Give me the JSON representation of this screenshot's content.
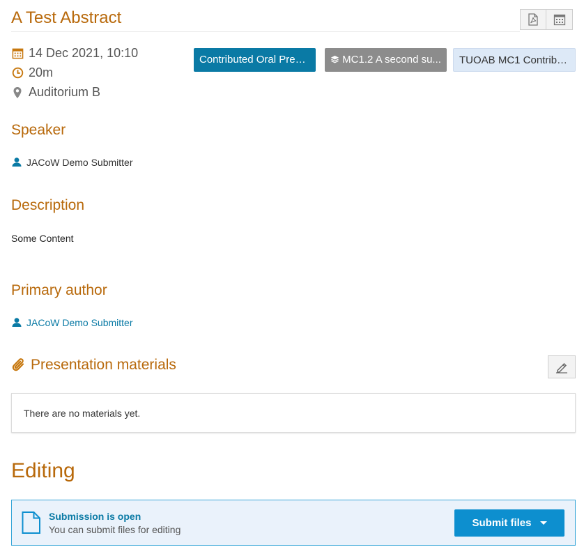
{
  "contribution": {
    "title": "A Test Abstract",
    "date": "14 Dec 2021, 10:10",
    "duration": "20m",
    "location": "Auditorium B"
  },
  "toolbar": {
    "pdf_icon": "pdf-file-icon",
    "calendar_icon": "calendar-icon"
  },
  "tags": {
    "type": "Contributed Oral Prese...",
    "session": "MC1.2 A second su...",
    "code": "TUOAB MC1 Contribut..."
  },
  "sections": {
    "speaker_heading": "Speaker",
    "speaker_name": "JACoW Demo Submitter",
    "description_heading": "Description",
    "description_text": "Some Content",
    "primary_author_heading": "Primary author",
    "primary_author_name": "JACoW Demo Submitter"
  },
  "materials": {
    "heading": "Presentation materials",
    "empty_text": "There are no materials yet."
  },
  "editing": {
    "heading": "Editing",
    "status_title": "Submission is open",
    "status_desc": "You can submit files for editing",
    "submit_label": "Submit files"
  },
  "colors": {
    "accent": "#b8690b",
    "primary": "#0a7aa5",
    "session_tag": "#8c8c8c",
    "code_tag_bg": "#dde9f7"
  }
}
